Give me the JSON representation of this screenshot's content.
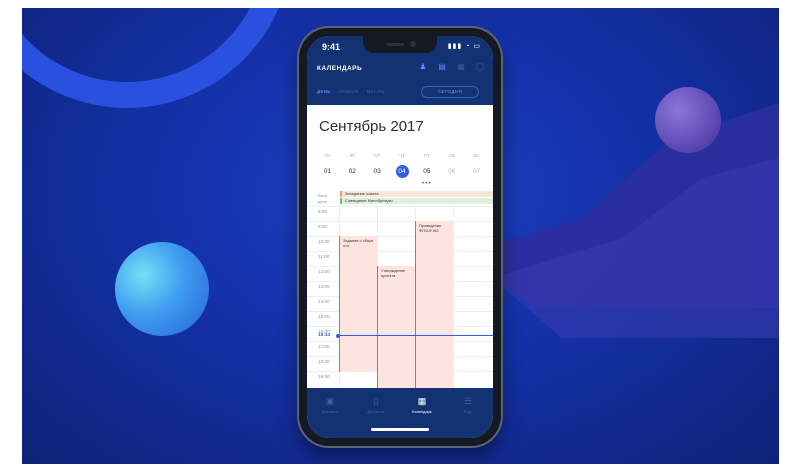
{
  "status": {
    "time": "9:41",
    "icons": "▮▮▮ ◔ ▭"
  },
  "header": {
    "title": "КАЛЕНДАРЬ",
    "icons": [
      "people-icon",
      "document-icon",
      "grid-icon",
      "clock-icon"
    ]
  },
  "tabs": [
    {
      "label": "ДЕНЬ",
      "active": true
    },
    {
      "label": "НЕДЕЛЯ",
      "active": false
    },
    {
      "label": "МЕСЯЦ",
      "active": false
    }
  ],
  "today_button": "СЕГОДНЯ",
  "month_title": "Сентябрь 2017",
  "weekdays": [
    "ПН",
    "ВТ",
    "СР",
    "ЧТ",
    "ПТ",
    "СБ",
    "ВС"
  ],
  "dates": [
    "01",
    "02",
    "03",
    "04",
    "05",
    "06",
    "07"
  ],
  "selected_date": "04",
  "allday_label": [
    "Весь",
    "день"
  ],
  "allday_events": [
    "Заседание совета",
    "Совещание Минобрнауки"
  ],
  "hours": [
    "8:00",
    "9:00",
    "10:00",
    "11:00",
    "12:00",
    "13:00",
    "14:00",
    "15:00",
    "16:00",
    "17:00",
    "18:00",
    "19:00"
  ],
  "now": "16:34",
  "events": [
    {
      "title": "Задание о сборе отч."
    },
    {
      "title": "Утверждение проекта"
    },
    {
      "title": "Проведение ФГБОУ ВО"
    }
  ],
  "tabbar": [
    {
      "label": "Контакты",
      "icon": "contacts-icon"
    },
    {
      "label": "Документ",
      "icon": "document-icon"
    },
    {
      "label": "Календарь",
      "icon": "calendar-icon",
      "active": true
    },
    {
      "label": "Еще",
      "icon": "menu-icon"
    }
  ],
  "colors": {
    "background": "#1431a8",
    "header": "#123274",
    "accent": "#2f5fd9",
    "event": "#fde4df"
  }
}
